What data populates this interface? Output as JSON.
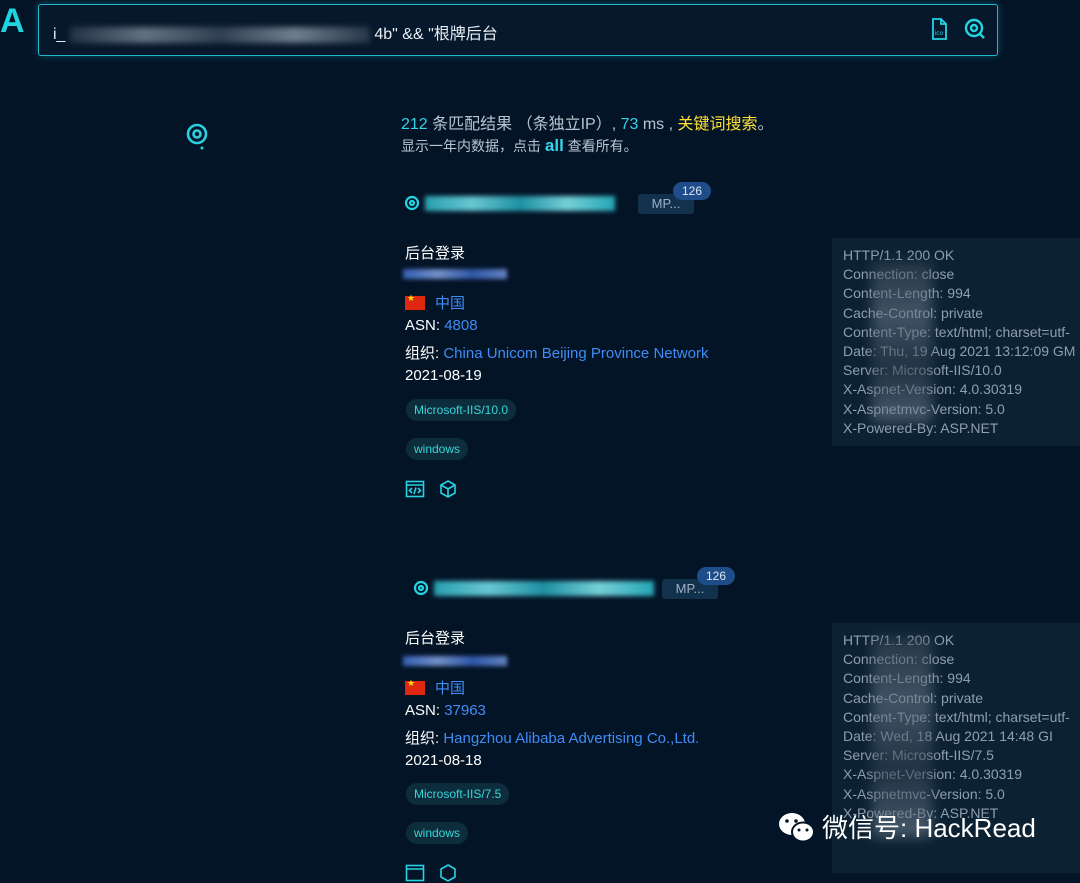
{
  "logo": "A",
  "search": {
    "query_visible": "4b\" && \"根牌后台",
    "query_prefix": "i_"
  },
  "summary": {
    "count": "212",
    "text1": " 条匹配结果 （条独立IP）, ",
    "ms": "73",
    "text2": " ms , ",
    "keyword_link": "关键词搜索",
    "period": "。",
    "line2_pre": "显示一年内数据，点击 ",
    "all_link": "all",
    "line2_post": " 查看所有。"
  },
  "results": [
    {
      "port_tag": "MP...",
      "badge": "126",
      "title": "后台登录",
      "country": "中国",
      "asn_label": "ASN: ",
      "asn": "4808",
      "org_label": "组织: ",
      "org": "China Unicom Beijing Province Network",
      "date": "2021-08-19",
      "tags": [
        "Microsoft-IIS/10.0",
        "windows"
      ],
      "headers": [
        "HTTP/1.1 200 OK",
        "Connection: close",
        "Content-Length: 994",
        "Cache-Control: private",
        "Content-Type: text/html; charset=utf-",
        "Date: Thu, 19 Aug 2021 13:12:09 GM",
        "Server: Microsoft-IIS/10.0",
        "X-Aspnet-Version: 4.0.30319",
        "X-Aspnetmvc-Version: 5.0",
        "X-Powered-By: ASP.NET"
      ]
    },
    {
      "port_tag": "MP...",
      "badge": "126",
      "title": "后台登录",
      "country": "中国",
      "asn_label": "ASN: ",
      "asn": "37963",
      "org_label": "组织: ",
      "org": "Hangzhou Alibaba Advertising Co.,Ltd.",
      "date": "2021-08-18",
      "tags": [
        "Microsoft-IIS/7.5",
        "windows"
      ],
      "headers": [
        "HTTP/1.1 200 OK",
        "Connection: close",
        "Content-Length: 994",
        "Cache-Control: private",
        "Content-Type: text/html; charset=utf-",
        "Date: Wed, 18 Aug 2021 14:48 GI",
        "Server: Microsoft-IIS/7.5",
        "X-Aspnet-Version: 4.0.30319",
        "X-Aspnetmvc-Version: 5.0",
        "X-Powered-By: ASP.NET"
      ]
    }
  ],
  "watermark": "微信号: HackRead",
  "icons": {
    "search_bar_icon1": "ico-file-icon",
    "search_bar_icon2": "search-icon",
    "sidebar": "location-search-icon",
    "result_code": "code-icon",
    "result_cube": "cube-icon"
  },
  "colors": {
    "accent": "#24d4e2",
    "link": "#3f8cf5",
    "keyword": "#ffe033",
    "bg": "#041427"
  }
}
